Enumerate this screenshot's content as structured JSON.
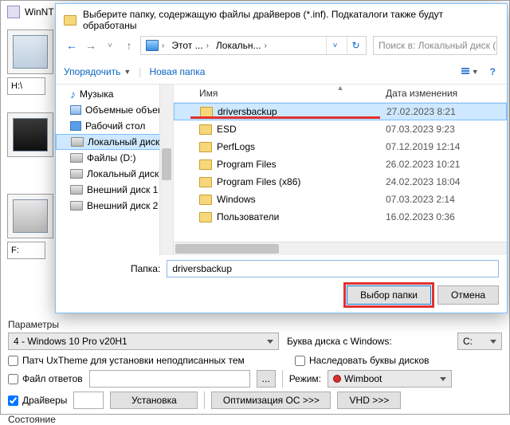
{
  "bg": {
    "title": "WinNT",
    "dev_dd": "H:\\",
    "dev_dd2": "F:"
  },
  "dialog": {
    "title": "Выберите папку, содержащую файлы драйверов (*.inf). Подкаталоги также будут обработаны",
    "breadcrumb": {
      "pc": "Этот ...",
      "drive": "Локальн..."
    },
    "search_placeholder": "Поиск в: Локальный диск (C:)",
    "toolbar": {
      "organize": "Упорядочить",
      "new_folder": "Новая папка"
    },
    "tree": [
      {
        "icon": "note",
        "label": "Музыка"
      },
      {
        "icon": "cube",
        "label": "Объемные объек"
      },
      {
        "icon": "desk",
        "label": "Рабочий стол"
      },
      {
        "icon": "hd",
        "label": "Локальный диск (",
        "selected": true
      },
      {
        "icon": "hd",
        "label": "Файлы (D:)"
      },
      {
        "icon": "hd",
        "label": "Локальный диск ("
      },
      {
        "icon": "hd",
        "label": "Внешний диск 1 ("
      },
      {
        "icon": "hd",
        "label": "Внешний диск 2 ("
      }
    ],
    "columns": {
      "name": "Имя",
      "date": "Дата изменения"
    },
    "rows": [
      {
        "name": "driversbackup",
        "date": "27.02.2023 8:21",
        "selected": true,
        "underline": true
      },
      {
        "name": "ESD",
        "date": "07.03.2023 9:23"
      },
      {
        "name": "PerfLogs",
        "date": "07.12.2019 12:14"
      },
      {
        "name": "Program Files",
        "date": "26.02.2023 10:21"
      },
      {
        "name": "Program Files (x86)",
        "date": "24.02.2023 18:04"
      },
      {
        "name": "Windows",
        "date": "07.03.2023 2:14"
      },
      {
        "name": "Пользователи",
        "date": "16.02.2023 0:36"
      }
    ],
    "folder_label": "Папка:",
    "folder_value": "driversbackup",
    "select_btn": "Выбор папки",
    "cancel_btn": "Отмена"
  },
  "lower": {
    "params_label": "Параметры",
    "edition": "4 - Windows 10 Pro v20H1",
    "drive_letter_label": "Буква диска с Windows:",
    "drive_letter": "C:",
    "uxtheme": "Патч UxTheme для установки неподписанных тем",
    "inherit_letters": "Наследовать буквы дисков",
    "answer_file": "Файл ответов",
    "mode_label": "Режим:",
    "wimboot": "Wimboot",
    "drivers": "Драйверы",
    "install": "Установка",
    "optimize": "Оптимизация ОС >>>",
    "vhd": "VHD  >>>",
    "state_label": "Состояние"
  }
}
